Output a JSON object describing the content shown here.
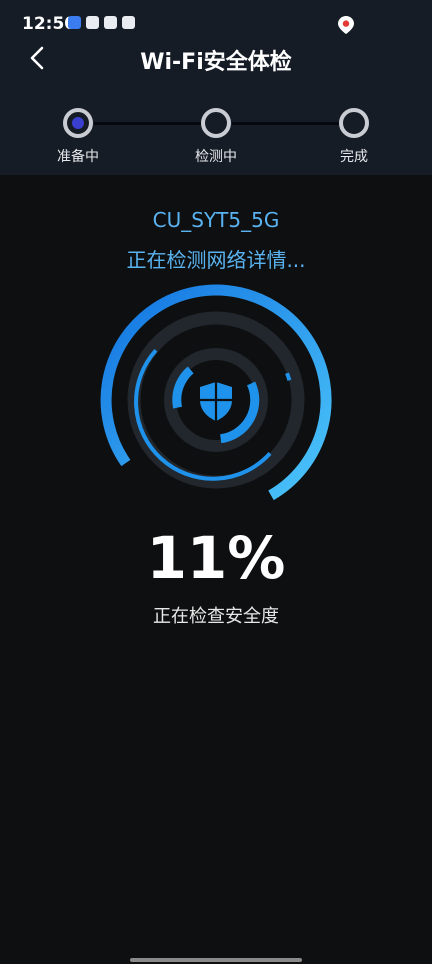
{
  "status_bar": {
    "time": "12:50"
  },
  "header": {
    "title": "Wi-Fi安全体检"
  },
  "steps": [
    {
      "label": "准备中",
      "state": "active"
    },
    {
      "label": "检测中",
      "state": "pending"
    },
    {
      "label": "完成",
      "state": "pending"
    }
  ],
  "network": {
    "ssid": "CU_SYT5_5G",
    "status_text": "正在检测网络详情..."
  },
  "progress": {
    "percent_text": "11%",
    "value": 11,
    "subtitle": "正在检查安全度"
  },
  "colors": {
    "accent": "#5ab3f0",
    "header_bg": "#151c26",
    "page_bg": "#0e0f10",
    "active_dot": "#3a3fd0"
  },
  "icons": {
    "back": "back-arrow-icon",
    "shield": "shield-icon",
    "location": "location-pin-icon"
  }
}
